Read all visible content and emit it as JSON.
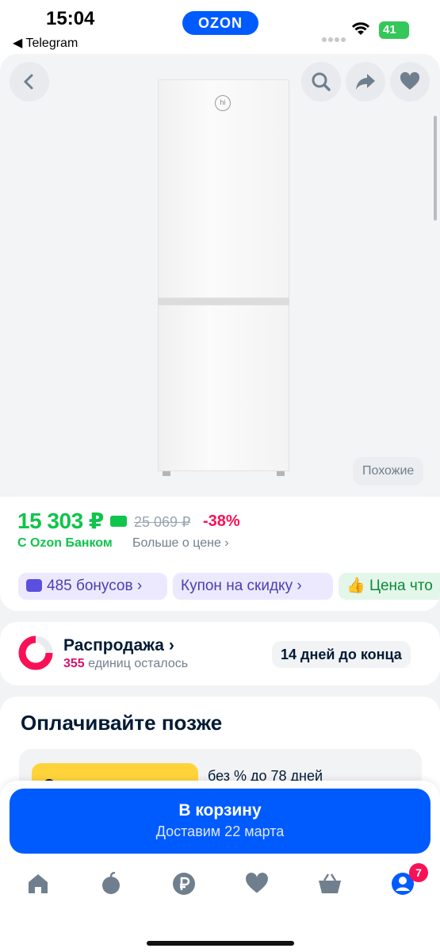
{
  "status_bar": {
    "time": "15:04",
    "back_app": "◀ Telegram",
    "brand_pill": "OZON",
    "battery": "41"
  },
  "product": {
    "similar_label": "Похожие"
  },
  "price": {
    "current": "15 303 ₽",
    "old": "25 069 ₽",
    "discount": "-38%",
    "bank_label": "С Ozon Банком",
    "more_label": "Больше о цене ›"
  },
  "chips": {
    "bonus": "485 бонусов ›",
    "coupon": "Купон на скидку ›",
    "price_good": "Цена что"
  },
  "sale": {
    "title": "Распродажа ›",
    "remaining_count": "355",
    "remaining_text": " единиц осталось",
    "days_left": "14 дней до конца"
  },
  "pay_later": {
    "title": "Оплачивайте позже",
    "promo_text": "без % до 78 дней"
  },
  "cart": {
    "button_label": "В корзину",
    "delivery": "Доставим 22 марта"
  },
  "tabbar": {
    "items": [
      {
        "icon": "home-icon"
      },
      {
        "icon": "fresh-icon"
      },
      {
        "icon": "ruble-icon"
      },
      {
        "icon": "heart-icon"
      },
      {
        "icon": "basket-icon"
      },
      {
        "icon": "profile-icon"
      }
    ],
    "profile_badge": "7"
  },
  "colors": {
    "brand": "#005bff",
    "price_green": "#10c44c",
    "discount_pink": "#f91155"
  }
}
